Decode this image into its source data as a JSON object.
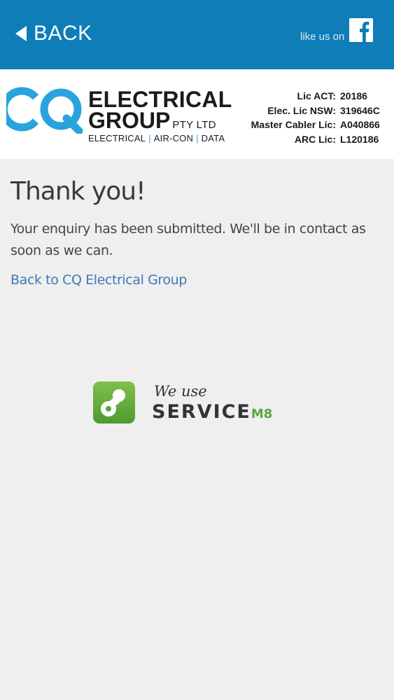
{
  "topbar": {
    "back_label": "BACK",
    "like_label": "like us on",
    "facebook_icon": "facebook-icon",
    "color": "#0e7db8"
  },
  "brand": {
    "logo_letters": "CQ",
    "name_line1": "ELECTRICAL",
    "name_line2": "GROUP",
    "suffix": "PTY LTD",
    "services": [
      "ELECTRICAL",
      "AIR-CON",
      "DATA"
    ],
    "logo_color": "#29a3dd"
  },
  "licences": [
    {
      "label": "Lic ACT:",
      "value": "20186"
    },
    {
      "label": "Elec. Lic NSW:",
      "value": "319646C"
    },
    {
      "label": "Master Cabler Lic:",
      "value": "A040866"
    },
    {
      "label": "ARC Lic:",
      "value": "L120186"
    }
  ],
  "main": {
    "title": "Thank you!",
    "message": "Your enquiry has been submitted. We'll be in contact as soon as we can.",
    "link": "Back to CQ Electrical Group"
  },
  "badge": {
    "tagline": "We use",
    "word": "SERVICE",
    "suffix": "M8",
    "icon": "servicem8-icon",
    "accent": "#5aa741"
  }
}
